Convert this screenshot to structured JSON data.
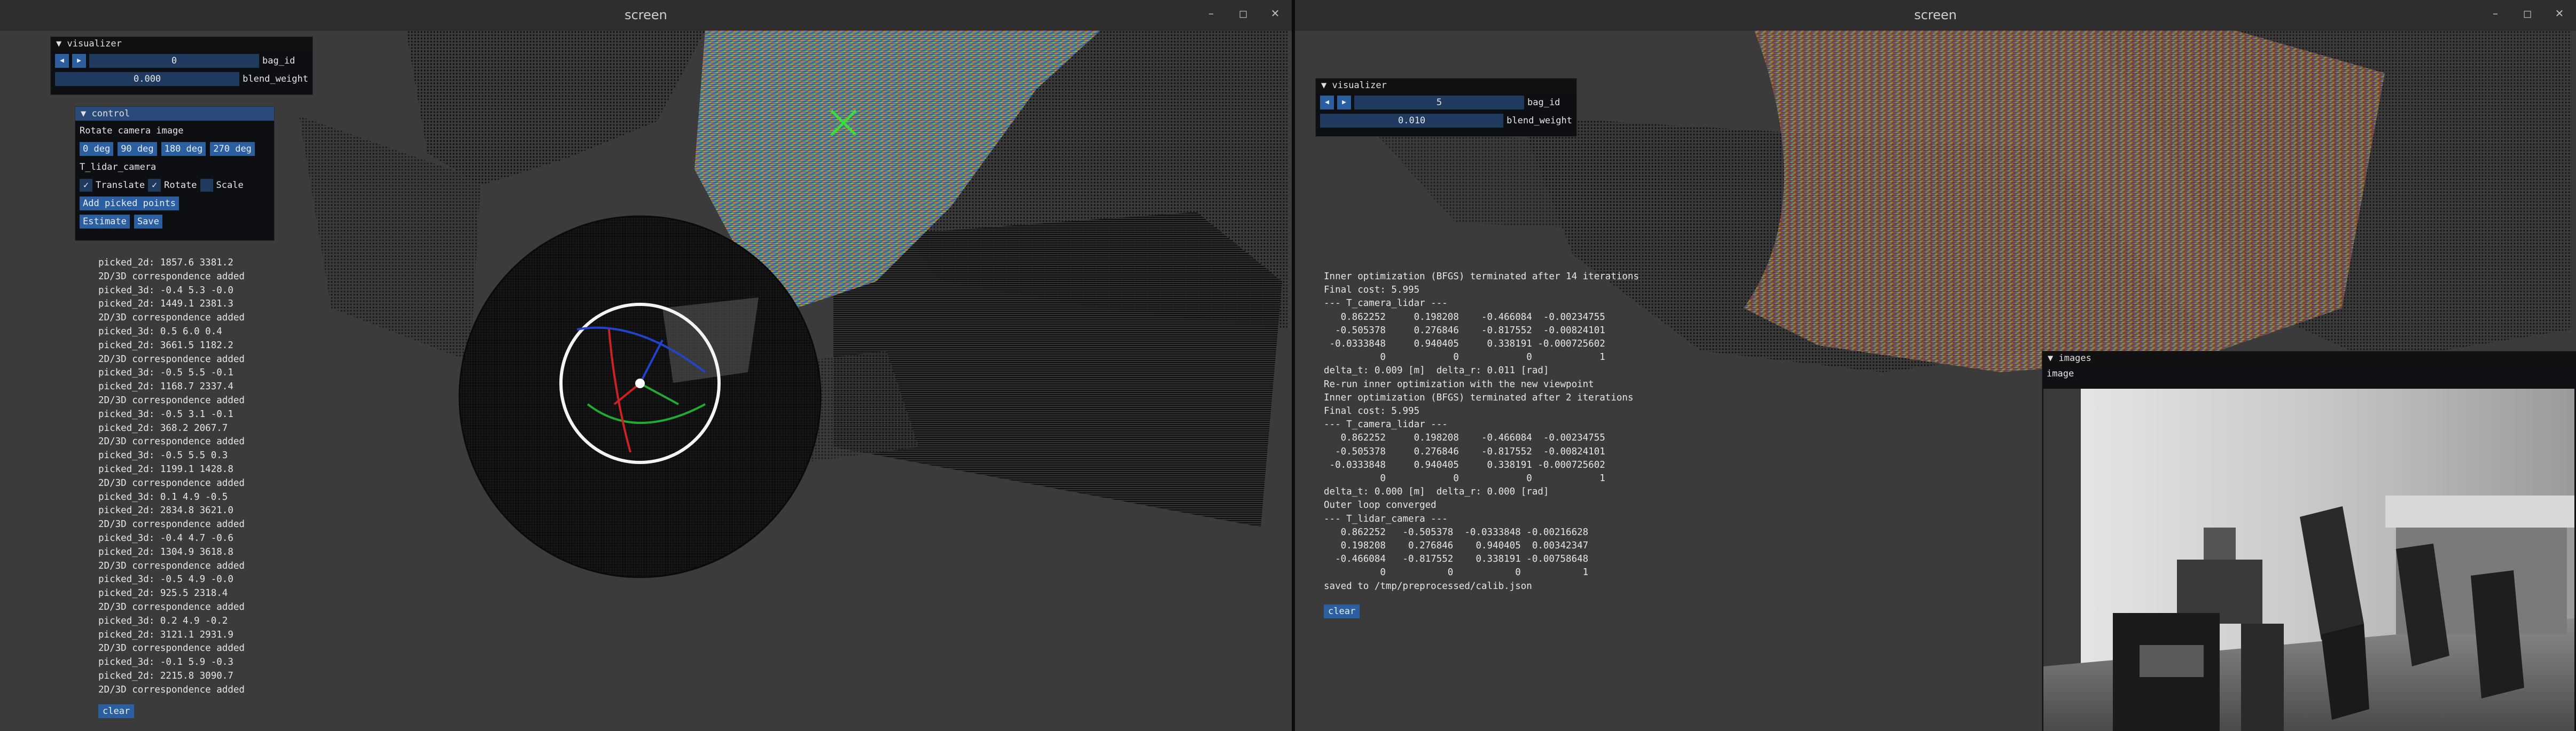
{
  "left": {
    "window_title": "screen",
    "window_buttons": [
      "–",
      "◻",
      "✕"
    ],
    "visualizer": {
      "title": "▼ visualizer",
      "bag_id_value": "0",
      "bag_id_label": "bag_id",
      "blend_value": "0.000",
      "blend_label": "blend_weight"
    },
    "control": {
      "title": "▼ control",
      "rotate_label": "Rotate camera image",
      "rotate_options": [
        "0 deg",
        "90 deg",
        "180 deg",
        "270 deg"
      ],
      "t_label": "T_lidar_camera",
      "translate_label": "Translate",
      "rotate_check_label": "Rotate",
      "scale_label": "Scale",
      "add_points_label": "Add picked points",
      "estimate_label": "Estimate",
      "save_label": "Save"
    },
    "log": [
      "picked_2d: 1857.6 3381.2",
      "2D/3D correspondence added",
      "picked_3d: -0.4 5.3 -0.0",
      "picked_2d: 1449.1 2381.3",
      "2D/3D correspondence added",
      "picked_3d: 0.5 6.0 0.4",
      "picked_2d: 3661.5 1182.2",
      "2D/3D correspondence added",
      "picked_3d: -0.5 5.5 -0.1",
      "picked_2d: 1168.7 2337.4",
      "2D/3D correspondence added",
      "picked_3d: -0.5 3.1 -0.1",
      "picked_2d: 368.2 2067.7",
      "2D/3D correspondence added",
      "picked_3d: -0.5 5.5 0.3",
      "picked_2d: 1199.1 1428.8",
      "2D/3D correspondence added",
      "picked_3d: 0.1 4.9 -0.5",
      "picked_2d: 2834.8 3621.0",
      "2D/3D correspondence added",
      "picked_3d: -0.4 4.7 -0.6",
      "picked_2d: 1304.9 3618.8",
      "2D/3D correspondence added",
      "picked_3d: -0.5 4.9 -0.0",
      "picked_2d: 925.5 2318.4",
      "2D/3D correspondence added",
      "picked_3d: 0.2 4.9 -0.2",
      "picked_2d: 3121.1 2931.9",
      "2D/3D correspondence added",
      "picked_3d: -0.1 5.9 -0.3",
      "picked_2d: 2215.8 3090.7",
      "2D/3D correspondence added"
    ],
    "clear_label": "clear"
  },
  "right": {
    "window_title": "screen",
    "window_buttons": [
      "–",
      "◻",
      "✕"
    ],
    "visualizer": {
      "title": "▼ visualizer",
      "bag_id_value": "5",
      "bag_id_label": "bag_id",
      "blend_value": "0.010",
      "blend_label": "blend_weight"
    },
    "log": [
      "Inner optimization (BFGS) terminated after 14 iterations",
      "Final cost: 5.995",
      "--- T_camera_lidar ---",
      "   0.862252     0.198208    -0.466084  -0.00234755",
      "  -0.505378     0.276846    -0.817552  -0.00824101",
      " -0.0333848     0.940405     0.338191 -0.000725602",
      "          0            0            0            1",
      "delta_t: 0.009 [m]  delta_r: 0.011 [rad]",
      "Re-run inner optimization with the new viewpoint",
      "Inner optimization (BFGS) terminated after 2 iterations",
      "Final cost: 5.995",
      "--- T_camera_lidar ---",
      "   0.862252     0.198208    -0.466084  -0.00234755",
      "  -0.505378     0.276846    -0.817552  -0.00824101",
      " -0.0333848     0.940405     0.338191 -0.000725602",
      "          0            0            0            1",
      "delta_t: 0.000 [m]  delta_r: 0.000 [rad]",
      "Outer loop converged",
      "--- T_lidar_camera ---",
      "   0.862252   -0.505378  -0.0333848 -0.00216628",
      "   0.198208    0.276846    0.940405  0.00342347",
      "  -0.466084   -0.817552    0.338191 -0.00758648",
      "          0           0           0           1",
      "saved to /tmp/preprocessed/calib.json"
    ],
    "clear_label": "clear",
    "images": {
      "title": "▼ images",
      "label": "image"
    }
  }
}
